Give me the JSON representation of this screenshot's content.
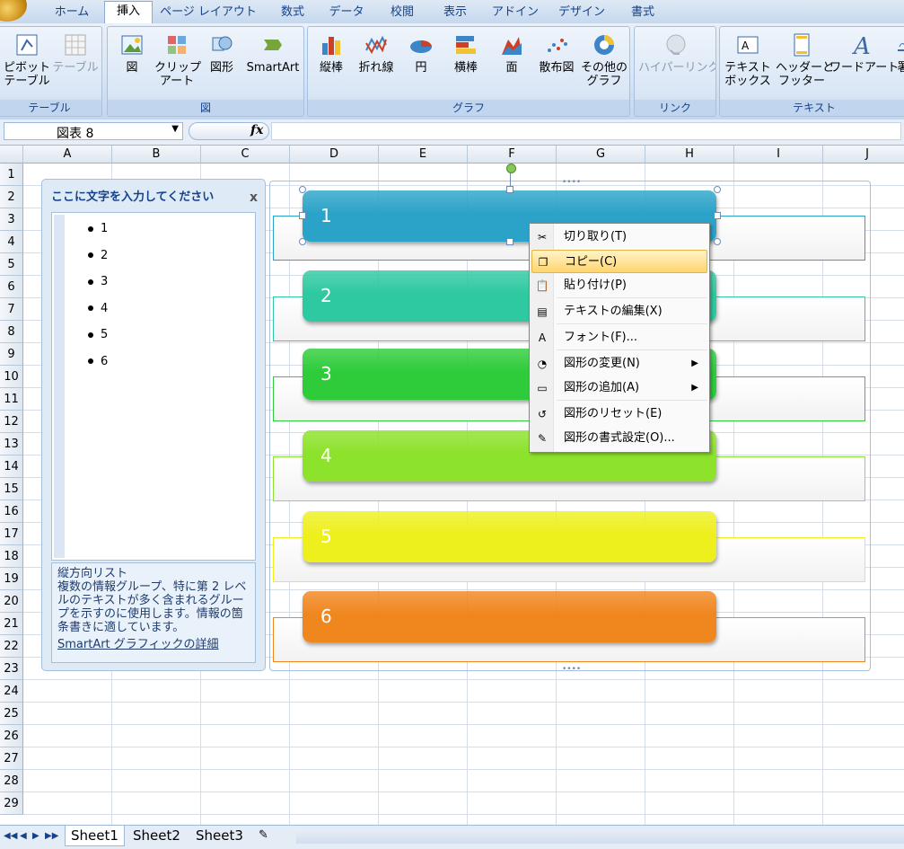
{
  "ribbon": {
    "tabs": [
      "ホーム",
      "挿入",
      "ページ レイアウト",
      "数式",
      "データ",
      "校閲",
      "表示",
      "アドイン",
      "デザイン",
      "書式"
    ],
    "active_tab": "挿入",
    "groups": {
      "table": {
        "label": "テーブル",
        "pivot_line1": "ピボット",
        "pivot_line2": "テーブル",
        "table": "テーブル"
      },
      "illustrations": {
        "label": "図",
        "picture": "図",
        "clipart_line1": "クリップ",
        "clipart_line2": "アート",
        "shapes": "図形",
        "smartart": "SmartArt"
      },
      "charts": {
        "label": "グラフ",
        "column": "縦棒",
        "line": "折れ線",
        "pie": "円",
        "bar": "横棒",
        "area": "面",
        "scatter": "散布図",
        "other_line1": "その他の",
        "other_line2": "グラフ"
      },
      "links": {
        "label": "リンク",
        "hyperlink": "ハイパーリンク"
      },
      "text": {
        "label": "テキスト",
        "textbox_line1": "テキスト",
        "textbox_line2": "ボックス",
        "header_line1": "ヘッダーと",
        "header_line2": "フッター",
        "wordart": "ワードアート",
        "more": "署"
      }
    }
  },
  "formula_bar": {
    "name_box": "図表 8",
    "fx": "fx",
    "formula": ""
  },
  "columns": [
    "A",
    "B",
    "C",
    "D",
    "E",
    "F",
    "G",
    "H",
    "I",
    "J"
  ],
  "rows": [
    "1",
    "2",
    "3",
    "4",
    "5",
    "6",
    "7",
    "8",
    "9",
    "10",
    "11",
    "12",
    "13",
    "14",
    "15",
    "16",
    "17",
    "18",
    "19",
    "20",
    "21",
    "22",
    "23",
    "24",
    "25",
    "26",
    "27",
    "28",
    "29"
  ],
  "text_pane": {
    "title": "ここに文字を入力してください",
    "close": "x",
    "items": [
      "1",
      "2",
      "3",
      "4",
      "5",
      "6"
    ],
    "description": "縦方向リスト\n複数の情報グループ、特に第 2 レベルのテキストが多く含まれるグループを示すのに使用します。情報の箇条書きに適しています。",
    "desc_title": "縦方向リスト",
    "desc_body": "複数の情報グループ、特に第 2 レベルのテキストが多く含まれるグループを示すのに使用します。情報の箇条書きに適しています。",
    "link": "SmartArt グラフィックの詳細"
  },
  "smartart": {
    "boxes": [
      {
        "label": "1",
        "color": "#2ba3c9"
      },
      {
        "label": "2",
        "color": "#2ec9a0"
      },
      {
        "label": "3",
        "color": "#2ecc3a"
      },
      {
        "label": "4",
        "color": "#8de22b"
      },
      {
        "label": "5",
        "color": "#eef01e"
      },
      {
        "label": "6",
        "color": "#f0861e"
      }
    ]
  },
  "context_menu": {
    "items": [
      {
        "label": "切り取り(T)",
        "icon": "scissors-icon"
      },
      {
        "label": "コピー(C)",
        "icon": "copy-icon",
        "highlighted": true
      },
      {
        "label": "貼り付け(P)",
        "icon": "paste-icon"
      },
      {
        "label": "テキストの編集(X)",
        "icon": "edit-text-icon"
      },
      {
        "label": "フォント(F)...",
        "icon": "font-icon"
      },
      {
        "label": "図形の変更(N)",
        "icon": "change-shape-icon",
        "submenu": true
      },
      {
        "label": "図形の追加(A)",
        "icon": "add-shape-icon",
        "submenu": true
      },
      {
        "label": "図形のリセット(E)",
        "icon": "reset-shape-icon"
      },
      {
        "label": "図形の書式設定(O)...",
        "icon": "format-shape-icon"
      }
    ]
  },
  "sheets": {
    "tabs": [
      "Sheet1",
      "Sheet2",
      "Sheet3"
    ],
    "active": "Sheet1"
  }
}
